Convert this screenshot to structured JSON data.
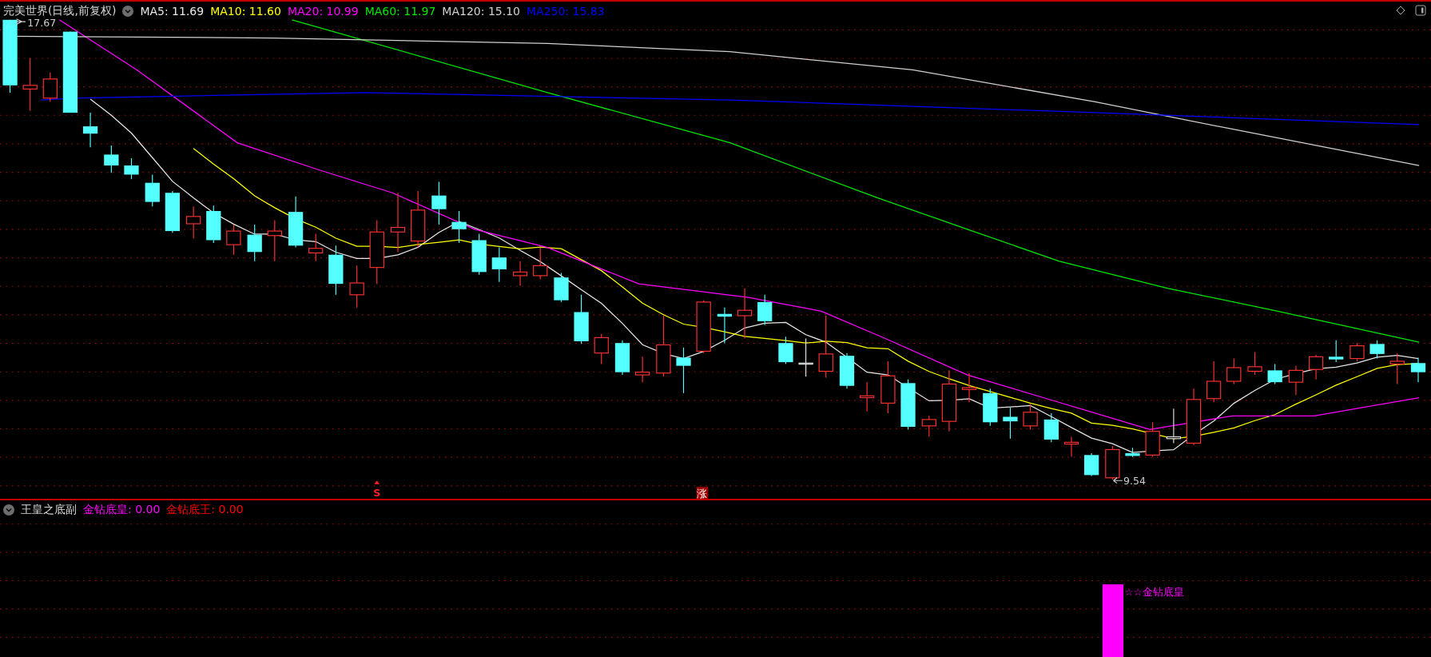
{
  "chart": {
    "title": "完美世界(日线,前复权)",
    "ma_legend": [
      {
        "label": "MA5: 11.69",
        "color": "#e6e6e6"
      },
      {
        "label": "MA10: 11.60",
        "color": "#ffff00"
      },
      {
        "label": "MA20: 10.99",
        "color": "#ff00ff"
      },
      {
        "label": "MA60: 11.97",
        "color": "#00e600"
      },
      {
        "label": "MA120: 15.10",
        "color": "#d0d0d0"
      },
      {
        "label": "MA250: 15.83",
        "color": "#0000ff"
      }
    ],
    "high_label": "17.67",
    "low_label": "9.54",
    "signals": [
      {
        "kind": "s",
        "text": "S"
      },
      {
        "kind": "badge",
        "text": "涨"
      }
    ]
  },
  "indicator": {
    "title": "王皇之底副",
    "values": [
      {
        "label": "金钻底皇: 0.00",
        "color": "#ff00ff"
      },
      {
        "label": "金钻底王: 0.00",
        "color": "#ff0000"
      }
    ],
    "signal_label": "☆☆金钻底皇"
  }
}
